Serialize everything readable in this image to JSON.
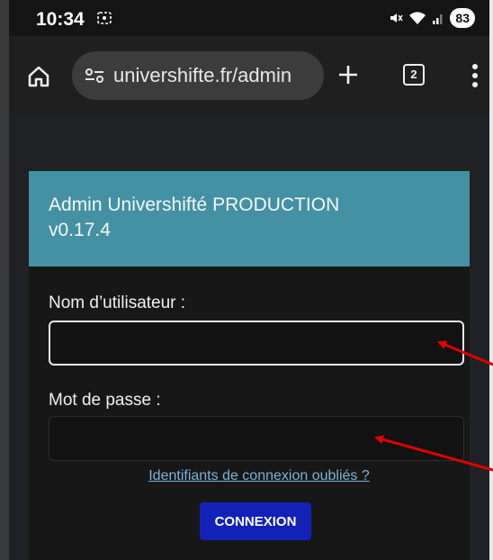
{
  "status_bar": {
    "time": "10:34",
    "battery": "83",
    "icons": [
      "screenshot-icon",
      "mute-icon",
      "wifi-icon",
      "signal-icon",
      "battery-icon"
    ]
  },
  "browser": {
    "url": "univershifte.fr/admin",
    "tab_count": "2",
    "icons": [
      "home-icon",
      "site-settings-icon",
      "new-tab-icon",
      "tabs-icon",
      "menu-icon"
    ]
  },
  "card": {
    "title_line1": "Admin Univershifté PRODUCTION",
    "title_line2": "v0.17.4",
    "header_color": "#4391a3",
    "username_label": "Nom d’utilisateur :",
    "username_value": "",
    "password_label": "Mot de passe :",
    "password_value": "",
    "forgot_link": "Identifiants de connexion oubliés ?",
    "login_button": "CONNEXION",
    "button_color": "#1222b7"
  },
  "annotations": {
    "arrow_color": "#e00000",
    "arrows": [
      "arrow-to-username",
      "arrow-to-password"
    ]
  }
}
